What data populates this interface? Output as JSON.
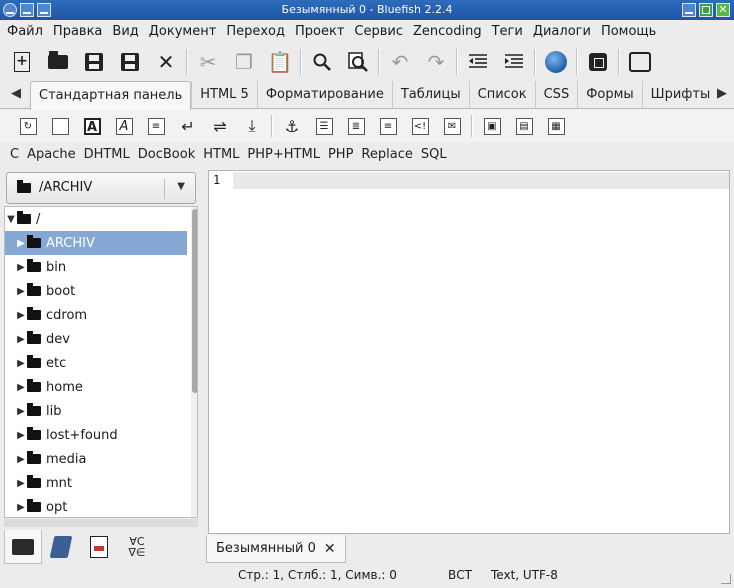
{
  "window": {
    "title": "Безымянный 0 - Bluefish 2.2.4"
  },
  "menu": [
    "Файл",
    "Правка",
    "Вид",
    "Документ",
    "Переход",
    "Проект",
    "Сервис",
    "Zencoding",
    "Теги",
    "Диалоги",
    "Помощь"
  ],
  "toolbar": {
    "icons": [
      "new-document-icon",
      "open-folder-icon",
      "save-icon",
      "save-as-icon",
      "close-icon",
      "cut-icon",
      "copy-icon",
      "paste-icon",
      "search-icon",
      "search-replace-icon",
      "undo-icon",
      "redo-icon",
      "unindent-icon",
      "indent-icon",
      "preview-globe-icon",
      "settings-icon",
      "fullscreen-icon"
    ]
  },
  "tabs": [
    "Стандартная панель",
    "HTML 5",
    "Форматирование",
    "Таблицы",
    "Список",
    "CSS",
    "Формы",
    "Шрифты"
  ],
  "active_tab": "Стандартная панель",
  "snippets": [
    "C",
    "Apache",
    "DHTML",
    "DocBook",
    "HTML",
    "PHP+HTML",
    "PHP",
    "Replace",
    "SQL"
  ],
  "filebrowser": {
    "path": "/ARCHIV",
    "root": "/",
    "items": [
      "ARCHIV",
      "bin",
      "boot",
      "cdrom",
      "dev",
      "etc",
      "home",
      "lib",
      "lost+found",
      "media",
      "mnt",
      "opt"
    ],
    "selected": "ARCHIV"
  },
  "editor": {
    "line_number": "1",
    "document_tab": "Безымянный 0"
  },
  "statusbar": {
    "position": "Стр.: 1, Стлб.: 1, Симв.: 0",
    "mode": "ВСТ",
    "encoding": "Text, UTF-8"
  },
  "colors": {
    "titlebar": "#2e6cbc",
    "selection": "#86a8d5",
    "globe": "#1f5ea8"
  }
}
